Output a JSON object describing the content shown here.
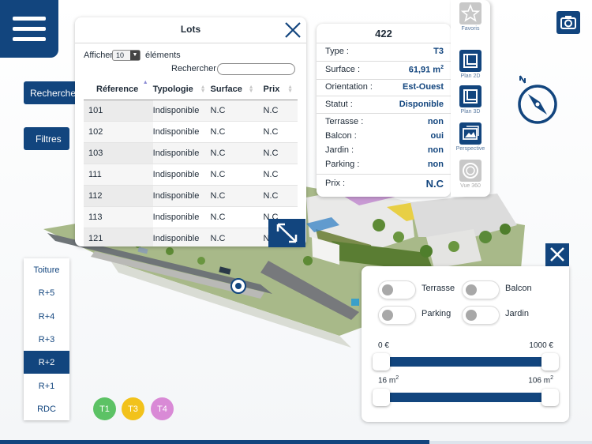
{
  "colors": {
    "primary": "#12457e",
    "t1": "#5cc265",
    "t2_t3": "#f2c21b",
    "t4": "#d98ad6"
  },
  "nav": {
    "menu_icon": "hamburger-icon",
    "search_by_button": "Recherche pa",
    "filters_button": "Filtres",
    "camera_icon": "camera-icon",
    "compass_icon": "compass-icon"
  },
  "lots_panel": {
    "title": "Lots",
    "show_label": "Afficher",
    "page_size": "10",
    "elements_label": "éléments",
    "search_label": "Rechercher :",
    "search_value": "",
    "columns": [
      "Réference",
      "Typologie",
      "Surface",
      "Prix"
    ],
    "rows": [
      [
        "101",
        "Indisponible",
        "N.C",
        "N.C"
      ],
      [
        "102",
        "Indisponible",
        "N.C",
        "N.C"
      ],
      [
        "103",
        "Indisponible",
        "N.C",
        "N.C"
      ],
      [
        "111",
        "Indisponible",
        "N.C",
        "N.C"
      ],
      [
        "112",
        "Indisponible",
        "N.C",
        "N.C"
      ],
      [
        "113",
        "Indisponible",
        "N.C",
        "N.C"
      ],
      [
        "121",
        "Indisponible",
        "N.C",
        "N.C"
      ]
    ],
    "close_icon": "close-icon",
    "expand_icon": "expand-icon"
  },
  "lot_detail": {
    "number": "422",
    "type_label": "Type :",
    "type_value": "T3",
    "surface_label": "Surface :",
    "surface_value": "61,91 m",
    "surface_exp": "2",
    "orientation_label": "Orientation :",
    "orientation_value": "Est-Ouest",
    "status_label": "Statut :",
    "status_value": "Disponible",
    "terrace_label": "Terrasse :",
    "terrace_value": "non",
    "balcony_label": "Balcon :",
    "balcony_value": "oui",
    "garden_label": "Jardin :",
    "garden_value": "non",
    "parking_label": "Parking :",
    "parking_value": "non",
    "price_label": "Prix :",
    "price_value": "N.C"
  },
  "views": {
    "favorites": "Favoris",
    "plan_2d": "Plan 2D",
    "plan_3d": "Plan 3D",
    "perspective": "Perspective",
    "vue_360": "Vue 360"
  },
  "floors": {
    "items": [
      "Toiture",
      "R+5",
      "R+4",
      "R+3",
      "R+2",
      "R+1",
      "RDC"
    ],
    "active": "R+2"
  },
  "types": [
    "T1",
    "T3",
    "T4"
  ],
  "filters": {
    "terrace": "Terrasse",
    "balcony": "Balcon",
    "parking": "Parking",
    "garden": "Jardin",
    "price_min": "0 €",
    "price_max": "1000 €",
    "price_range_fraction": [
      0,
      1
    ],
    "surface_min": "16 m",
    "surface_max": "106 m",
    "surface_exp": "2",
    "surface_range_fraction": [
      0,
      1
    ]
  }
}
